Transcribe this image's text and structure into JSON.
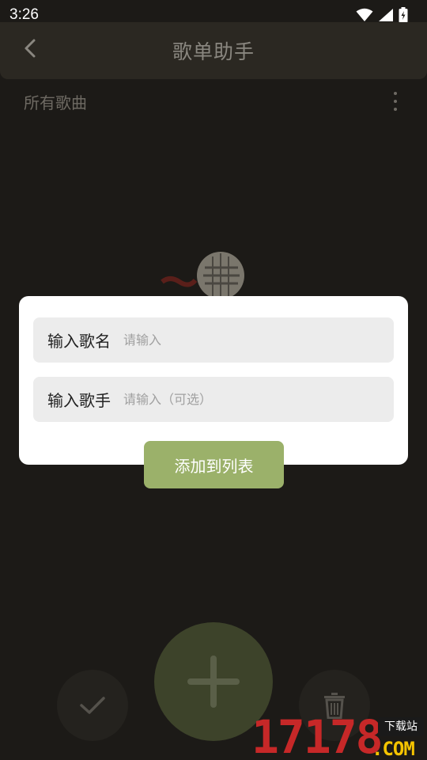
{
  "status_bar": {
    "time": "3:26"
  },
  "toolbar": {
    "title": "歌单助手"
  },
  "section": {
    "title": "所有歌曲"
  },
  "dialog": {
    "song_name": {
      "label": "输入歌名",
      "placeholder": "请输入",
      "value": ""
    },
    "singer": {
      "label": "输入歌手",
      "placeholder": "请输入（可选）",
      "value": ""
    },
    "add_button_label": "添加到列表"
  },
  "watermark": {
    "number": "17178",
    "badge": "下载站",
    "domain": ".COM"
  },
  "colors": {
    "accent": "#9bb16a",
    "fab_dimmed": "#3d432a",
    "background": "#1c1a17",
    "dialog": "#ffffff",
    "field": "#ececec"
  },
  "icons": [
    "back-arrow-icon",
    "more-vert-icon",
    "microphone-icon",
    "check-icon",
    "plus-icon",
    "trash-icon",
    "wifi-icon",
    "signal-icon",
    "battery-icon"
  ]
}
